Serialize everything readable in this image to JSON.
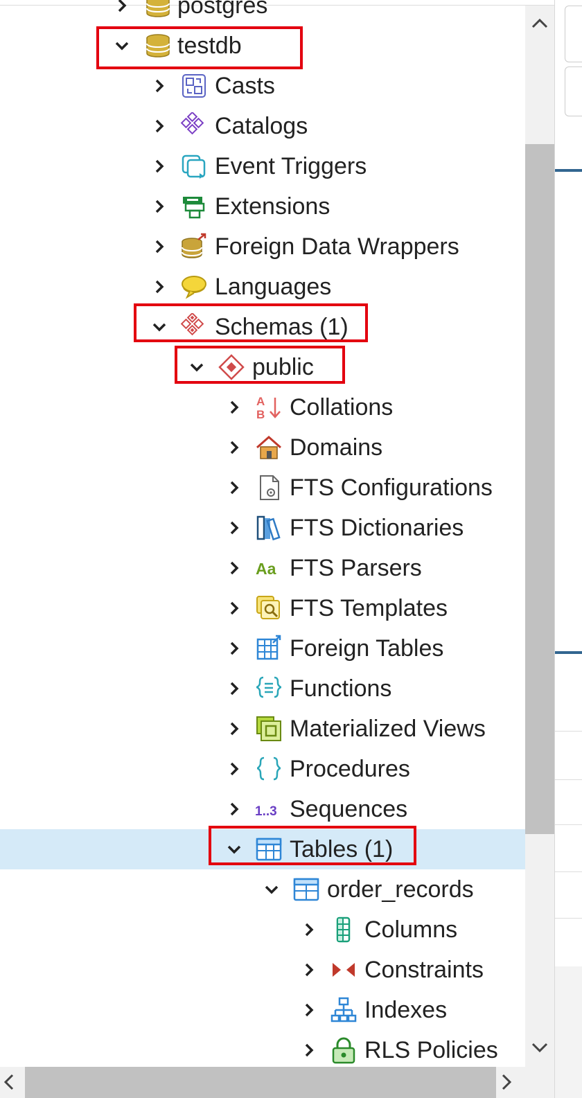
{
  "tree": {
    "rows": [
      {
        "label": "postgres",
        "level": 0,
        "expanded": false,
        "icon": "database-icon",
        "selected": false,
        "highlighted": false
      },
      {
        "label": "testdb",
        "level": 0,
        "expanded": true,
        "icon": "database-icon",
        "selected": false,
        "highlighted": true
      },
      {
        "label": "Casts",
        "level": 1,
        "expanded": false,
        "icon": "casts-icon",
        "selected": false,
        "highlighted": false
      },
      {
        "label": "Catalogs",
        "level": 1,
        "expanded": false,
        "icon": "catalogs-icon",
        "selected": false,
        "highlighted": false
      },
      {
        "label": "Event Triggers",
        "level": 1,
        "expanded": false,
        "icon": "event-triggers-icon",
        "selected": false,
        "highlighted": false
      },
      {
        "label": "Extensions",
        "level": 1,
        "expanded": false,
        "icon": "extensions-icon",
        "selected": false,
        "highlighted": false
      },
      {
        "label": "Foreign Data Wrappers",
        "level": 1,
        "expanded": false,
        "icon": "foreign-data-wrappers-icon",
        "selected": false,
        "highlighted": false
      },
      {
        "label": "Languages",
        "level": 1,
        "expanded": false,
        "icon": "languages-icon",
        "selected": false,
        "highlighted": false
      },
      {
        "label": "Schemas (1)",
        "level": 1,
        "expanded": true,
        "icon": "schemas-icon",
        "selected": false,
        "highlighted": true
      },
      {
        "label": "public",
        "level": 2,
        "expanded": true,
        "icon": "schema-icon",
        "selected": false,
        "highlighted": true
      },
      {
        "label": "Collations",
        "level": 3,
        "expanded": false,
        "icon": "collations-icon",
        "selected": false,
        "highlighted": false
      },
      {
        "label": "Domains",
        "level": 3,
        "expanded": false,
        "icon": "domains-icon",
        "selected": false,
        "highlighted": false
      },
      {
        "label": "FTS Configurations",
        "level": 3,
        "expanded": false,
        "icon": "fts-configurations-icon",
        "selected": false,
        "highlighted": false
      },
      {
        "label": "FTS Dictionaries",
        "level": 3,
        "expanded": false,
        "icon": "fts-dictionaries-icon",
        "selected": false,
        "highlighted": false
      },
      {
        "label": "FTS Parsers",
        "level": 3,
        "expanded": false,
        "icon": "fts-parsers-icon",
        "selected": false,
        "highlighted": false
      },
      {
        "label": "FTS Templates",
        "level": 3,
        "expanded": false,
        "icon": "fts-templates-icon",
        "selected": false,
        "highlighted": false
      },
      {
        "label": "Foreign Tables",
        "level": 3,
        "expanded": false,
        "icon": "foreign-tables-icon",
        "selected": false,
        "highlighted": false
      },
      {
        "label": "Functions",
        "level": 3,
        "expanded": false,
        "icon": "functions-icon",
        "selected": false,
        "highlighted": false
      },
      {
        "label": "Materialized Views",
        "level": 3,
        "expanded": false,
        "icon": "materialized-views-icon",
        "selected": false,
        "highlighted": false
      },
      {
        "label": "Procedures",
        "level": 3,
        "expanded": false,
        "icon": "procedures-icon",
        "selected": false,
        "highlighted": false
      },
      {
        "label": "Sequences",
        "level": 3,
        "expanded": false,
        "icon": "sequences-icon",
        "selected": false,
        "highlighted": false
      },
      {
        "label": "Tables (1)",
        "level": 3,
        "expanded": true,
        "icon": "tables-icon",
        "selected": true,
        "highlighted": true
      },
      {
        "label": "order_records",
        "level": 4,
        "expanded": true,
        "icon": "table-icon",
        "selected": false,
        "highlighted": false
      },
      {
        "label": "Columns",
        "level": 5,
        "expanded": false,
        "icon": "columns-icon",
        "selected": false,
        "highlighted": false
      },
      {
        "label": "Constraints",
        "level": 5,
        "expanded": false,
        "icon": "constraints-icon",
        "selected": false,
        "highlighted": false
      },
      {
        "label": "Indexes",
        "level": 5,
        "expanded": false,
        "icon": "indexes-icon",
        "selected": false,
        "highlighted": false
      },
      {
        "label": "RLS Policies",
        "level": 5,
        "expanded": false,
        "icon": "rls-policies-icon",
        "selected": false,
        "highlighted": false
      }
    ]
  },
  "colors": {
    "highlight_border": "#e3000f",
    "selected_row": "#d5eaf8",
    "chevron": "#222222"
  },
  "scrollbars": {
    "vertical": {
      "up_icon": "chevron-up-icon",
      "down_icon": "chevron-down-icon"
    },
    "horizontal": {
      "left_icon": "chevron-left-icon",
      "right_icon": "chevron-right-icon"
    }
  }
}
